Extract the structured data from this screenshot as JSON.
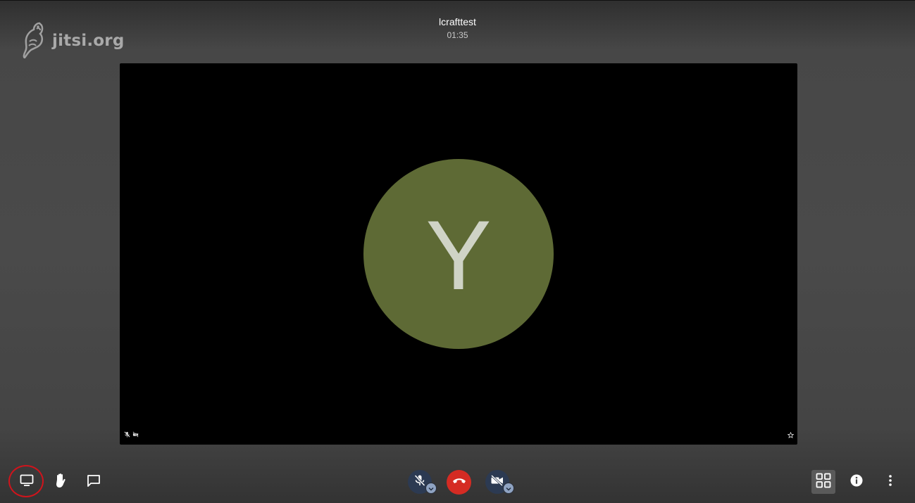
{
  "watermark": {
    "text": "jitsi.org"
  },
  "conference": {
    "subject": "lcrafttest",
    "timer": "01:35"
  },
  "participant": {
    "initial": "Y",
    "avatar_color": "#5e6a35"
  },
  "colors": {
    "hangup": "#d52b23",
    "toggled_off": "#2c3a52",
    "highlight_ring": "#d0141c",
    "tile_view_active": "#5a5a5a"
  },
  "toolbar": {
    "left": [
      "desktop-icon",
      "raise-hand-icon",
      "chat-icon"
    ],
    "center": [
      "microphone-muted-icon",
      "hangup-icon",
      "camera-off-icon"
    ],
    "right": [
      "tile-view-icon",
      "info-icon",
      "more-icon"
    ]
  }
}
